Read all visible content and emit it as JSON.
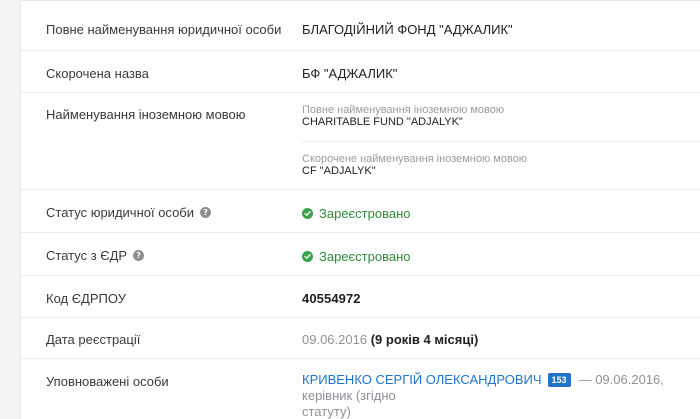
{
  "rows": {
    "full_name": {
      "label": "Повне найменування юридичної особи",
      "value": "БЛАГОДІЙНИЙ ФОНД \"АДЖАЛИК\""
    },
    "short_name": {
      "label": "Скорочена назва",
      "value": "БФ \"АДЖАЛИК\""
    },
    "foreign_name": {
      "label": "Найменування іноземною мовою",
      "full_caption": "Повне найменування іноземною мовою",
      "full_value": "CHARITABLE FUND \"ADJALYK\"",
      "short_caption": "Скорочене найменування іноземною мовою",
      "short_value": "CF \"ADJALYK\""
    },
    "legal_status": {
      "label": "Статус юридичної особи",
      "help": "?",
      "value": "Зареєстровано"
    },
    "edr_status": {
      "label": "Статус з ЄДР",
      "help": "?",
      "value": "Зареєстровано"
    },
    "edrpou": {
      "label": "Код ЄДРПОУ",
      "value": "40554972"
    },
    "registration": {
      "label": "Дата реєстрації",
      "date": "09.06.2016",
      "duration": "(9 років 4 місяці)"
    },
    "authorized": {
      "label": "Уповноважені особи",
      "person_name": "КРИВЕНКО СЕРГІЙ ОЛЕКСАНДРОВИЧ",
      "badge": "153",
      "details_line1": "— 09.06.2016, керівник (згідно",
      "details_line2": "статуту)"
    }
  },
  "colors": {
    "status_green": "#3aa24a",
    "link_blue": "#1f74c9",
    "muted_grey": "#8e9196"
  }
}
